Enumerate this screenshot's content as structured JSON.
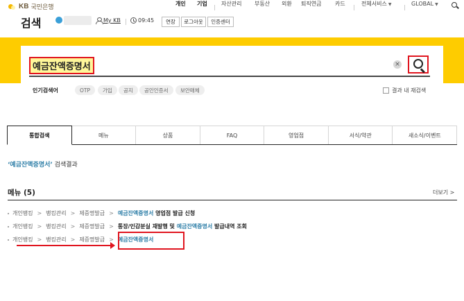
{
  "logo": {
    "brand": "KB",
    "bank_name": "국민은행"
  },
  "header": {
    "title": "검색",
    "mykb_label": "My KB",
    "time": "09:45",
    "extend_label": "연장",
    "logout_label": "로그아웃",
    "cert_center_label": "인증센터"
  },
  "topnav": {
    "personal": "개인",
    "business": "기업",
    "asset": "자산관리",
    "real_estate": "부동산",
    "fx": "외환",
    "pension": "퇴직연금",
    "card": "카드",
    "all_services": "전체서비스",
    "global": "GLOBAL"
  },
  "search": {
    "query": "예금잔액증명서",
    "clear_glyph": "×"
  },
  "popular": {
    "label": "인기검색어",
    "keywords": [
      "OTP",
      "가입",
      "공지",
      "공인인증서",
      "보안매체"
    ],
    "within_results_label": "결과 내 재검색"
  },
  "tabs": [
    "통합검색",
    "메뉴",
    "상품",
    "FAQ",
    "영업점",
    "서식/약관",
    "새소식/이벤트"
  ],
  "result_summary": {
    "open_quote": "‘",
    "keyword": "예금잔액증명서",
    "close_quote": "’",
    "suffix": " 검색결과"
  },
  "menu_section": {
    "title": "메뉴 (5)",
    "more_label": "더보기 >"
  },
  "results": [
    {
      "crumbs": [
        "개인뱅킹",
        "뱅킹관리",
        "제증명발급"
      ],
      "hl": "예금잔액증명서",
      "tail": " 영업점 발급 신청"
    },
    {
      "crumbs": [
        "개인뱅킹",
        "뱅킹관리",
        "제증명발급"
      ],
      "lead": "통장/인감분실 재발행 및 ",
      "hl": "예금잔액증명서",
      "tail": " 발급내역 조회"
    },
    {
      "crumbs": [
        "개인뱅킹",
        "뱅킹관리",
        "제증명발급"
      ],
      "hl": "예금잔액증명서"
    }
  ],
  "colors": {
    "brand_yellow": "#fecc00",
    "annotation_red": "#e0141e",
    "highlight_blue": "#2f7fa8"
  }
}
